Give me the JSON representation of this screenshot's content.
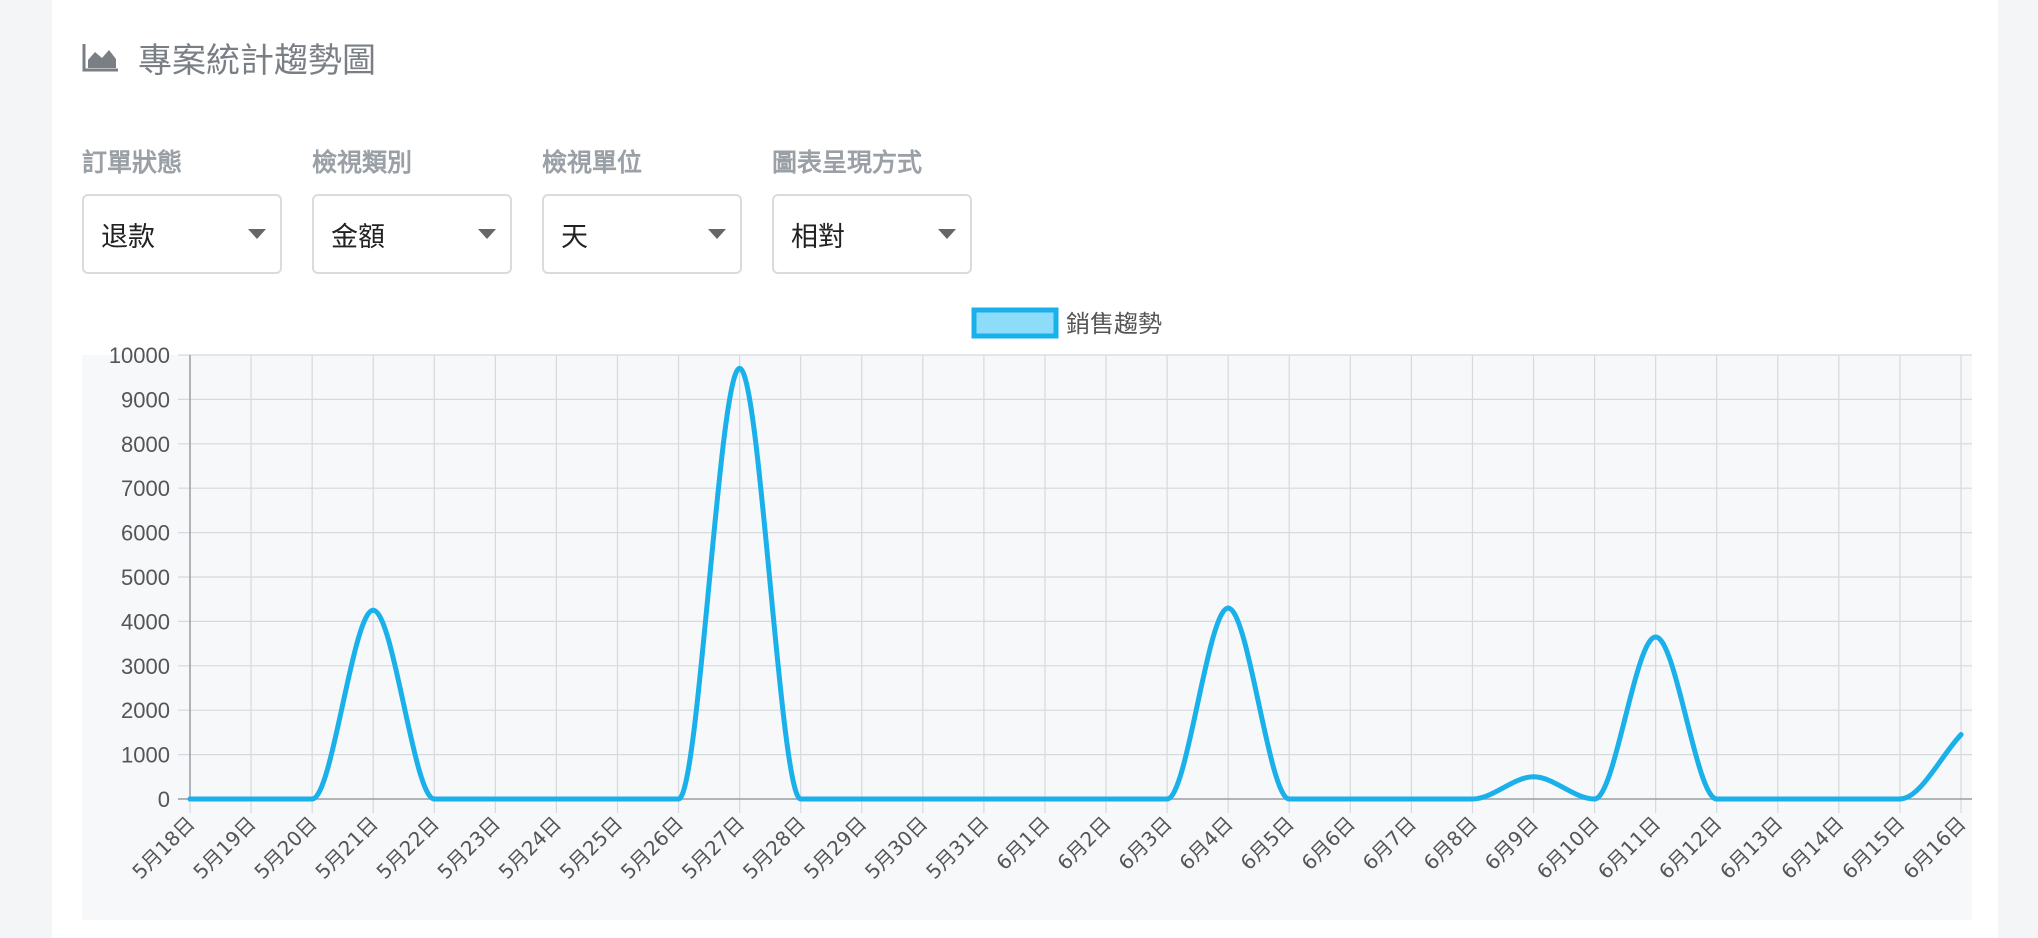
{
  "header": {
    "title": "專案統計趨勢圖",
    "icon": "area-chart-icon"
  },
  "filters": [
    {
      "label": "訂單狀態",
      "value": "退款"
    },
    {
      "label": "檢視類別",
      "value": "金額"
    },
    {
      "label": "檢視單位",
      "value": "天"
    },
    {
      "label": "圖表呈現方式",
      "value": "相對"
    }
  ],
  "colors": {
    "line": "#1ab0ea",
    "legend_fill": "#8ddcf9",
    "plot_bg": "#f7f8fa",
    "grid": "#d6d9dd"
  },
  "chart_data": {
    "type": "line",
    "title": "",
    "xlabel": "",
    "ylabel": "",
    "legend_position": "top-center",
    "grid": true,
    "ylim": [
      0,
      10000
    ],
    "yticks": [
      0,
      1000,
      2000,
      3000,
      4000,
      5000,
      6000,
      7000,
      8000,
      9000,
      10000
    ],
    "categories": [
      "5月18日",
      "5月19日",
      "5月20日",
      "5月21日",
      "5月22日",
      "5月23日",
      "5月24日",
      "5月25日",
      "5月26日",
      "5月27日",
      "5月28日",
      "5月29日",
      "5月30日",
      "5月31日",
      "6月1日",
      "6月2日",
      "6月3日",
      "6月4日",
      "6月5日",
      "6月6日",
      "6月7日",
      "6月8日",
      "6月9日",
      "6月10日",
      "6月11日",
      "6月12日",
      "6月13日",
      "6月14日",
      "6月15日",
      "6月16日"
    ],
    "series": [
      {
        "name": "銷售趨勢",
        "values": [
          0,
          0,
          0,
          4250,
          0,
          0,
          0,
          0,
          0,
          9700,
          0,
          0,
          0,
          0,
          0,
          0,
          0,
          4300,
          0,
          0,
          0,
          0,
          500,
          0,
          3650,
          0,
          0,
          0,
          0,
          1450
        ]
      }
    ]
  }
}
